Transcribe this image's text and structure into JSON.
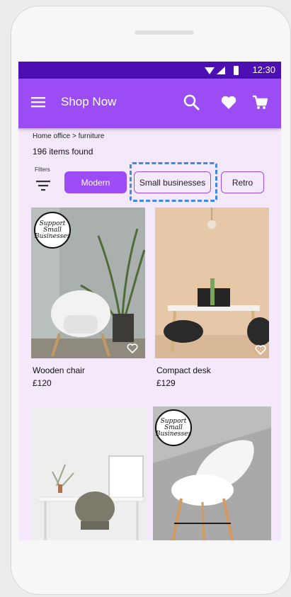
{
  "status_bar": {
    "time": "12:30"
  },
  "app_bar": {
    "title": "Shop Now",
    "icons": [
      "menu-icon",
      "search-icon",
      "heart-icon",
      "cart-icon"
    ]
  },
  "breadcrumb": "Home office > furniture",
  "results": {
    "count_text": "196 items found"
  },
  "filters": {
    "label": "Filters",
    "chips": [
      {
        "label": "Modern",
        "selected": true
      },
      {
        "label": "Small businesses",
        "selected": false,
        "highlighted": true
      },
      {
        "label": "Retro",
        "selected": false
      }
    ]
  },
  "products": [
    {
      "name": "Wooden chair",
      "price": "£120",
      "badge": [
        "Support",
        "Small",
        "Businesses"
      ]
    },
    {
      "name": "Compact desk",
      "price": "£129",
      "badge": []
    },
    {
      "name": "",
      "price": "",
      "badge": []
    },
    {
      "name": "",
      "price": "",
      "badge": [
        "Support",
        "Small",
        "Businesses"
      ]
    }
  ],
  "colors": {
    "accent": "#9b4cf4",
    "status_bar": "#4b0fb2",
    "background": "#f3e9fb",
    "highlight": "#3e89e8"
  }
}
